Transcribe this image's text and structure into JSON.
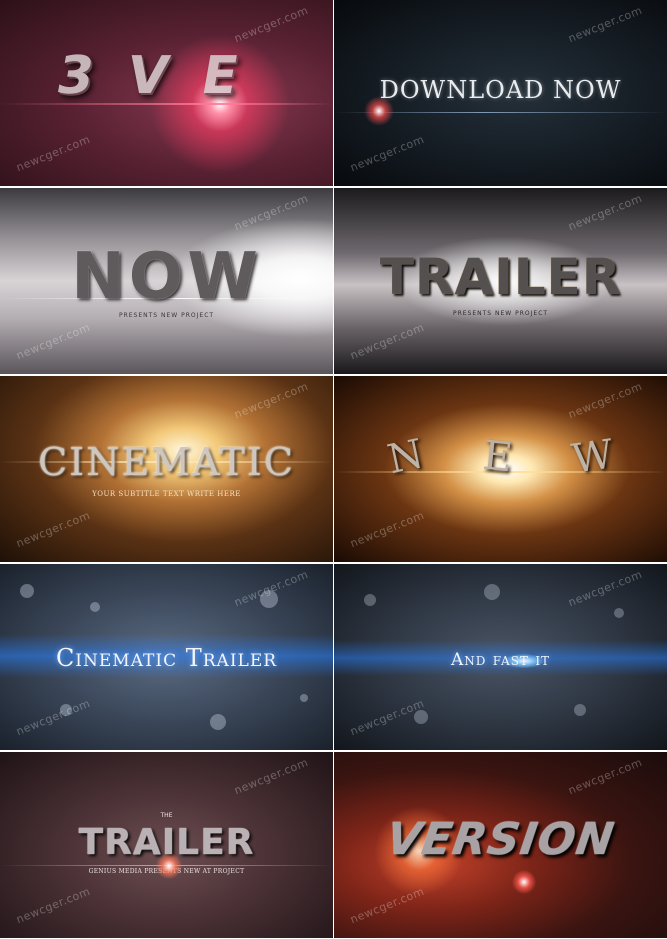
{
  "watermark": "newcger.com",
  "tiles": [
    {
      "id": "t1",
      "title": "3 V E",
      "subtitle": ""
    },
    {
      "id": "t2",
      "title": "DOWNLOAD NOW",
      "subtitle": ""
    },
    {
      "id": "t3",
      "title": "NOW",
      "subtitle": "PRESENTS NEW PROJECT"
    },
    {
      "id": "t4",
      "title": "TRAILER",
      "subtitle": "PRESENTS NEW PROJECT"
    },
    {
      "id": "t5",
      "title": "CINEMATIC",
      "subtitle": "YOUR SUBTITLE TEXT WRITE HERE"
    },
    {
      "id": "t6",
      "letters": [
        "N",
        "E",
        "W"
      ]
    },
    {
      "id": "t7",
      "title": "Cinematic Trailer"
    },
    {
      "id": "t8",
      "title": "And fast  it"
    },
    {
      "id": "t9",
      "pretitle": "THE",
      "title": "TRAILER",
      "subtitle": "GENIUS MEDIA PRESENTS NEW AT PROJECT"
    },
    {
      "id": "t10",
      "title": "VERSION"
    }
  ]
}
